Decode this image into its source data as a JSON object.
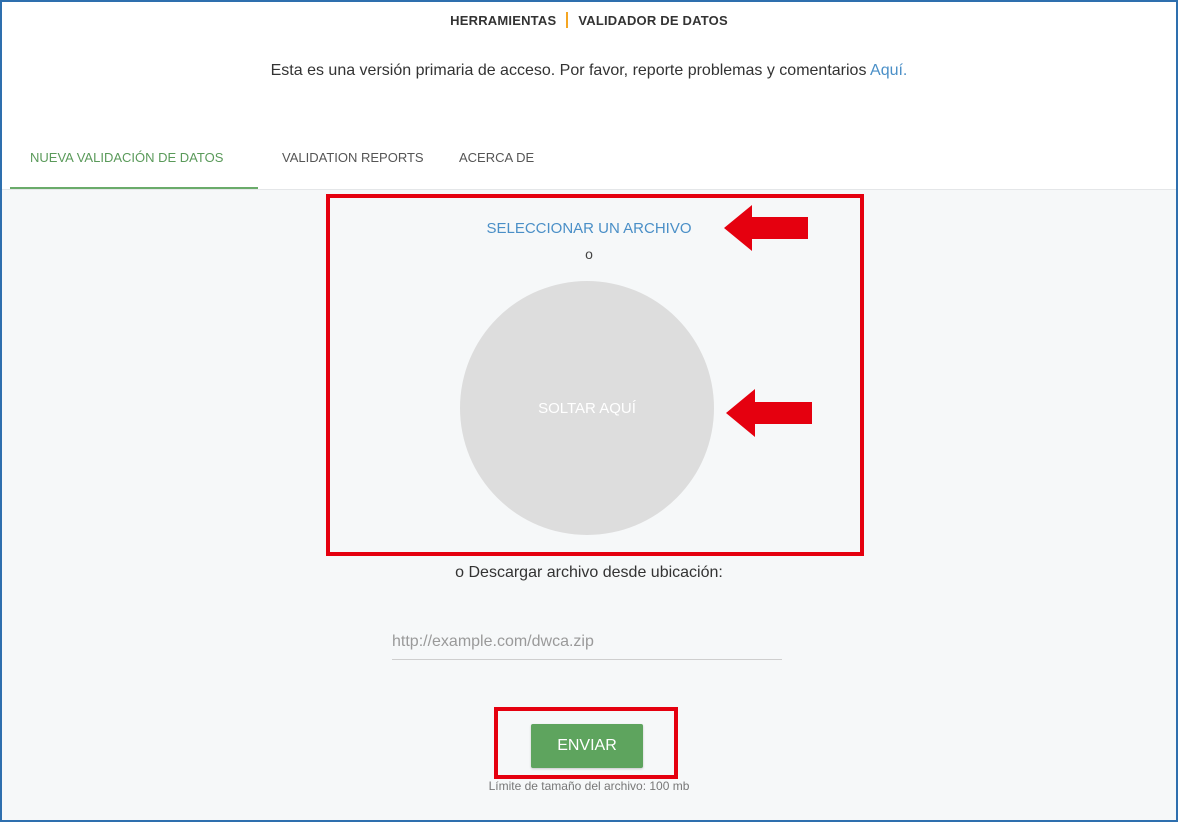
{
  "header": {
    "breadcrumb": {
      "section": "HERRAMIENTAS",
      "page": "VALIDADOR DE DATOS"
    },
    "notice_text": "Esta es una versión primaria de acceso. Por favor, reporte problemas y comentarios ",
    "notice_link": "Aquí."
  },
  "tabs": [
    {
      "label": "NUEVA VALIDACIÓN DE DATOS",
      "active": true
    },
    {
      "label": "VALIDATION REPORTS",
      "active": false
    },
    {
      "label": "ACERCA DE",
      "active": false
    }
  ],
  "upload": {
    "select_file_label": "SELECCIONAR UN ARCHIVO",
    "or_label": "o",
    "drop_label": "SOLTAR AQUÍ",
    "download_label": "o Descargar archivo desde ubicación:",
    "url_placeholder": "http://example.com/dwca.zip",
    "url_value": "",
    "submit_label": "ENVIAR",
    "size_limit": "Límite de tamaño del archivo: 100 mb"
  },
  "annotations": {
    "highlight_color": "#e5000f",
    "arrow_icon": "arrow-left-icon"
  },
  "colors": {
    "accent_green": "#5ea45e",
    "link_blue": "#4a8fc7",
    "breadcrumb_separator": "#f5a623",
    "drop_zone": "#dddddd"
  }
}
